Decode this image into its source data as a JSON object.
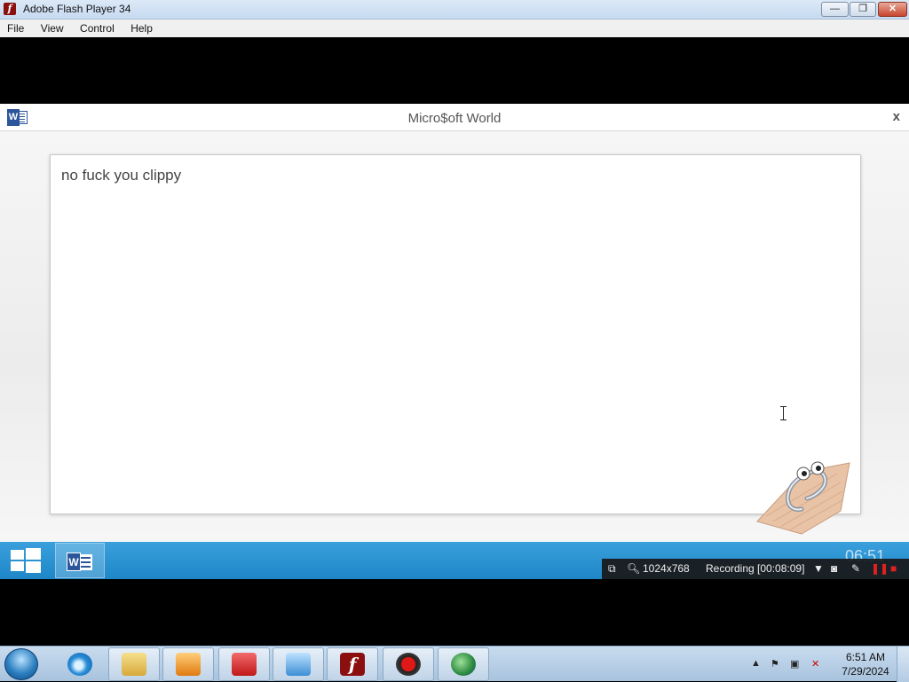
{
  "window": {
    "title": "Adobe Flash Player 34",
    "app_icon": "flash-icon",
    "controls": {
      "minimize": "—",
      "maximize": "❐",
      "close": "✕"
    }
  },
  "menu": [
    "File",
    "View",
    "Control",
    "Help"
  ],
  "app": {
    "title": "Micro$oft World",
    "close_label": "x",
    "document_text": "no fuck you clippy"
  },
  "inner_taskbar": {
    "clock_fragment": "06:51"
  },
  "recorder": {
    "resolution": "1024x768",
    "status": "Recording [00:08:09]"
  },
  "tray": {
    "time": "6:51 AM",
    "date": "7/29/2024"
  },
  "taskbar_apps": [
    "internet-explorer-icon",
    "file-explorer-icon",
    "media-player-icon",
    "gns3-icon",
    "control-panel-icon",
    "flash-player-icon",
    "recorder-icon",
    "network-globe-icon"
  ],
  "colors": {
    "word_blue": "#2b579a",
    "flash_red": "#8b0f0f",
    "taskbar_blue": "#1e86c8"
  }
}
